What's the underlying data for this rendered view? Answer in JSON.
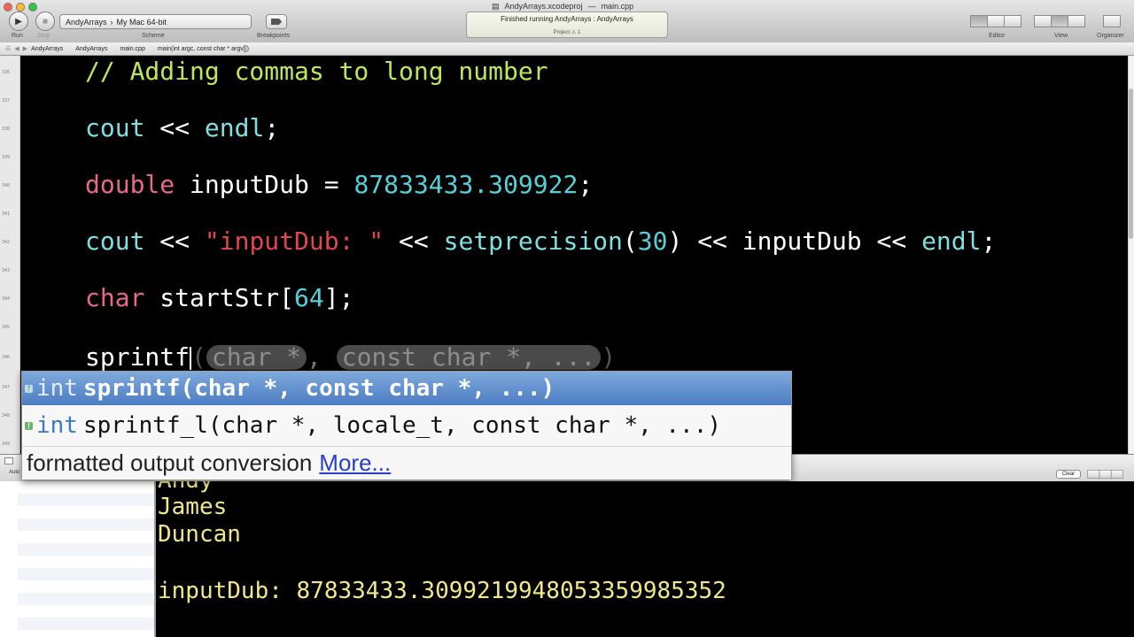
{
  "toolbar": {
    "run_label": "Run",
    "stop_label": "Stop",
    "scheme_target": "AndyArrays",
    "scheme_separator": "›",
    "scheme_destination": "My Mac 64-bit",
    "scheme_label": "Scheme",
    "breakpoints_label": "Breakpoints",
    "window_title_project": "AndyArrays.xcodeproj",
    "window_title_dash": "—",
    "window_title_file": "main.cpp",
    "activity_status": "Finished running AndyArrays : AndyArrays",
    "activity_project": "Project   ⚠ 1",
    "editor_label": "Editor",
    "view_label": "View",
    "organizer_label": "Organizer"
  },
  "jumpbar": {
    "crumbs": [
      "AndyArrays",
      "AndyArrays",
      "main.cpp",
      "main(int argc, const char * argv[])"
    ]
  },
  "gutter": {
    "line_numbers": [
      "336",
      "337",
      "338",
      "339",
      "340",
      "341",
      "342",
      "343",
      "344",
      "345",
      "346",
      "347",
      "348",
      "349"
    ]
  },
  "editor": {
    "line1": {
      "comment": "// Adding commas to long number"
    },
    "line2": {
      "fn": "cout",
      "op": " << ",
      "fn2": "endl",
      "end": ";"
    },
    "line3": {
      "kw": "double",
      "ident": " inputDub = ",
      "num": "87833433.309922",
      "end": ";"
    },
    "line4": {
      "fn": "cout",
      "op1": " << ",
      "str": "\"inputDub: \"",
      "op2": " << ",
      "fn2": "setprecision",
      "p1": "(",
      "num": "30",
      "p2": ")",
      "op3": " << ",
      "ident": "inputDub",
      "op4": " << ",
      "fn3": "endl",
      "end": ";"
    },
    "line5": {
      "kw": "char",
      "ident": " startStr[",
      "num": "64",
      "end": "];"
    },
    "line6": {
      "ident": "sprintf",
      "open": "(",
      "ph1": "char *",
      "comma": ", ",
      "ph2": "const char *, ...",
      "close": ")"
    }
  },
  "completion": {
    "items": [
      {
        "type": "int",
        "signature": "sprintf(char *, const char *, ...)"
      },
      {
        "type": "int",
        "signature": "sprintf_l(char *, locale_t, const char *, ...)"
      }
    ],
    "description": "formatted output conversion",
    "more_link": "More..."
  },
  "debug": {
    "auto_label": "Auto",
    "clear_label": "Clear",
    "console_lines": [
      "Andy",
      "James",
      "Duncan",
      "",
      "inputDub: 87833433.3099219948053359985352"
    ]
  },
  "colors": {
    "comment": "#bde85c",
    "function": "#7ee1e0",
    "keyword": "#e6698d",
    "number": "#55d0d6",
    "string": "#e0474b",
    "console_text": "#f0e88a",
    "selection": "#4b7dc2"
  }
}
